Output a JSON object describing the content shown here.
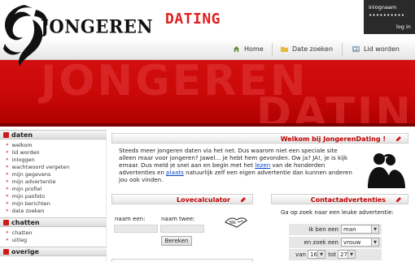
{
  "logo": {
    "main": "JONGEREN",
    "sub": "DATING"
  },
  "login": {
    "username_label": "inlognaam",
    "password_mask": "••••••••••",
    "button": "log in"
  },
  "nav": {
    "home": "Home",
    "date_zoeken": "Date zoeken",
    "lid_worden": "Lid worden"
  },
  "banner": {
    "word1": "JONGEREN",
    "word2": "DATING"
  },
  "sidebar": {
    "sections": [
      {
        "title": "daten",
        "items": [
          "welkom",
          "lid worden",
          "inloggen",
          "wachtwoord vergeten",
          "mijn gegevens",
          "mijn advertentie",
          "mijn profiel",
          "mijn pasfoto",
          "mijn berichten",
          "date zoeken"
        ]
      },
      {
        "title": "chatten",
        "items": [
          "chatten",
          "uitleg"
        ]
      },
      {
        "title": "overige",
        "items": []
      }
    ]
  },
  "welcome": {
    "title": "Welkom bij JongerenDating !",
    "text_before_lezen": "Steeds meer jongeren daten via het net. Dus waarom niet een speciale site alleen maar voor jongeren? Jawel... je hebt hem gevonden. Ow ja? JA!, je is kijk ernaar. Dus meld je snel aan en begin met het ",
    "link_lezen": "lezen",
    "text_between": " van de honderden advertenties en ",
    "link_plaats": "plaats",
    "text_after": " natuurlijk zelf een eigen advertentie dan kunnen anderen jou ook vinden."
  },
  "lovecalc": {
    "title": "Lovecalculator",
    "name1_label": "naam een:",
    "name2_label": "naam twee:",
    "button": "Bereken"
  },
  "contact": {
    "title": "Contactadvertenties",
    "intro": "Ga op zoek naar een leuke advertentie:",
    "ik_ben_label": "Ik ben een",
    "ik_ben_value": "man",
    "zoek_label": "en zoek een",
    "zoek_value": "vrouw",
    "van_label": "van",
    "van_value": "16",
    "tot_label": "tot",
    "tot_value": "27"
  },
  "colors": {
    "brand_red": "#c90808",
    "title_red": "#c00000",
    "link_blue": "#0044cc"
  }
}
